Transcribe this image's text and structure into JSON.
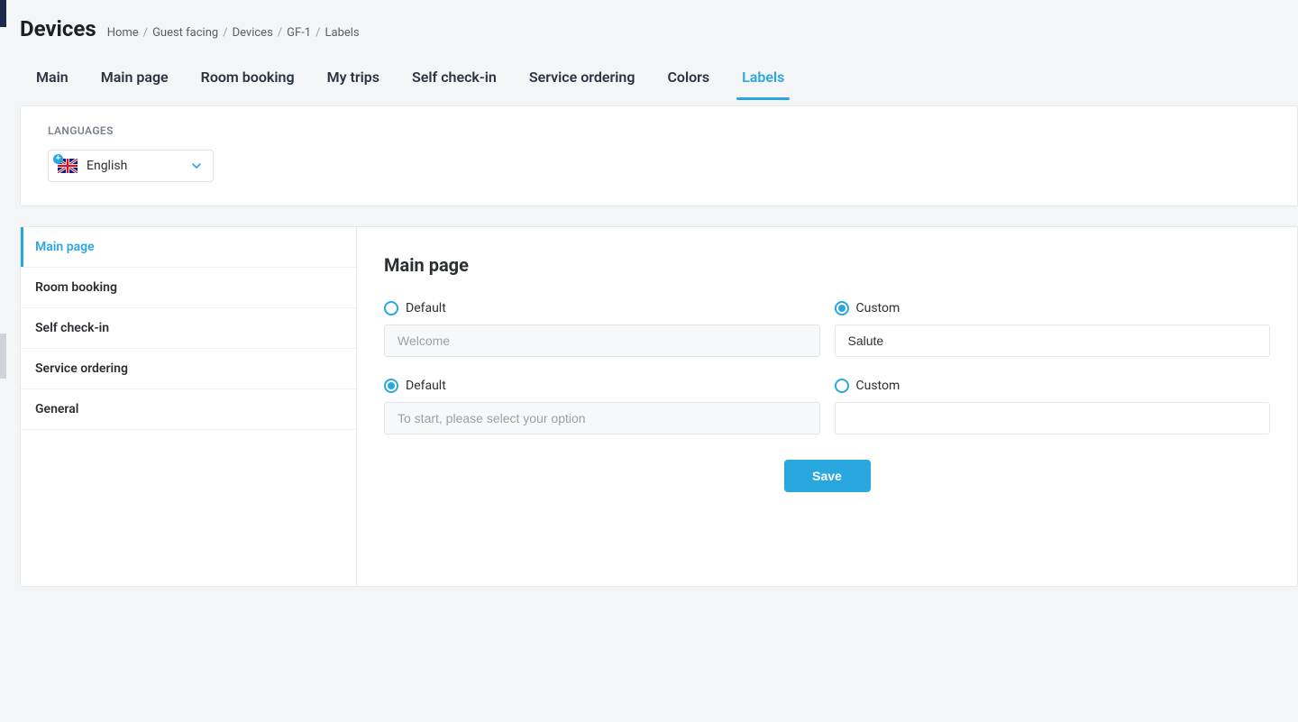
{
  "header": {
    "title": "Devices",
    "breadcrumb": [
      "Home",
      "Guest facing",
      "Devices",
      "GF-1",
      "Labels"
    ]
  },
  "tabs": [
    {
      "label": "Main",
      "active": false
    },
    {
      "label": "Main page",
      "active": false
    },
    {
      "label": "Room booking",
      "active": false
    },
    {
      "label": "My trips",
      "active": false
    },
    {
      "label": "Self check-in",
      "active": false
    },
    {
      "label": "Service ordering",
      "active": false
    },
    {
      "label": "Colors",
      "active": false
    },
    {
      "label": "Labels",
      "active": true
    }
  ],
  "languages": {
    "section_label": "LANGUAGES",
    "selected": "English"
  },
  "side_nav": [
    {
      "label": "Main page",
      "active": true
    },
    {
      "label": "Room booking",
      "active": false
    },
    {
      "label": "Self check-in",
      "active": false
    },
    {
      "label": "Service ordering",
      "active": false
    },
    {
      "label": "General",
      "active": false
    }
  ],
  "panel": {
    "title": "Main page",
    "rows": [
      {
        "default_label": "Default",
        "custom_label": "Custom",
        "default_selected": false,
        "default_placeholder": "Welcome",
        "custom_value": "Salute"
      },
      {
        "default_label": "Default",
        "custom_label": "Custom",
        "default_selected": true,
        "default_placeholder": "To start, please select your option",
        "custom_value": ""
      }
    ],
    "save_label": "Save"
  }
}
